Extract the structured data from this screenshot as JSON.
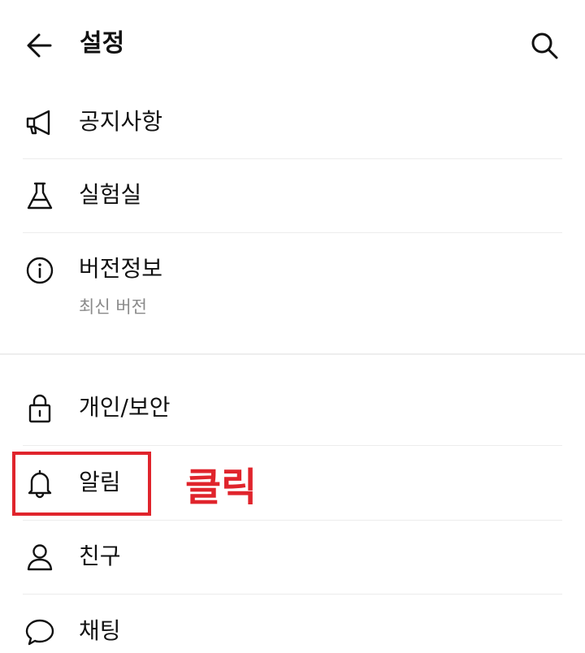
{
  "header": {
    "title": "설정",
    "back_icon": "arrow-left-icon",
    "search_icon": "search-icon"
  },
  "settings": {
    "notice": {
      "label": "공지사항",
      "icon": "megaphone-icon"
    },
    "lab": {
      "label": "실험실",
      "icon": "flask-icon"
    },
    "version": {
      "label": "버전정보",
      "sub": "최신 버전",
      "icon": "info-icon"
    },
    "privacy": {
      "label": "개인/보안",
      "icon": "lock-icon"
    },
    "notifications": {
      "label": "알림",
      "icon": "bell-icon"
    },
    "friends": {
      "label": "친구",
      "icon": "person-icon"
    },
    "chat": {
      "label": "채팅",
      "icon": "chat-bubble-icon"
    }
  },
  "annotation": {
    "text": "클릭",
    "color": "#e0242c",
    "target": "알림"
  }
}
